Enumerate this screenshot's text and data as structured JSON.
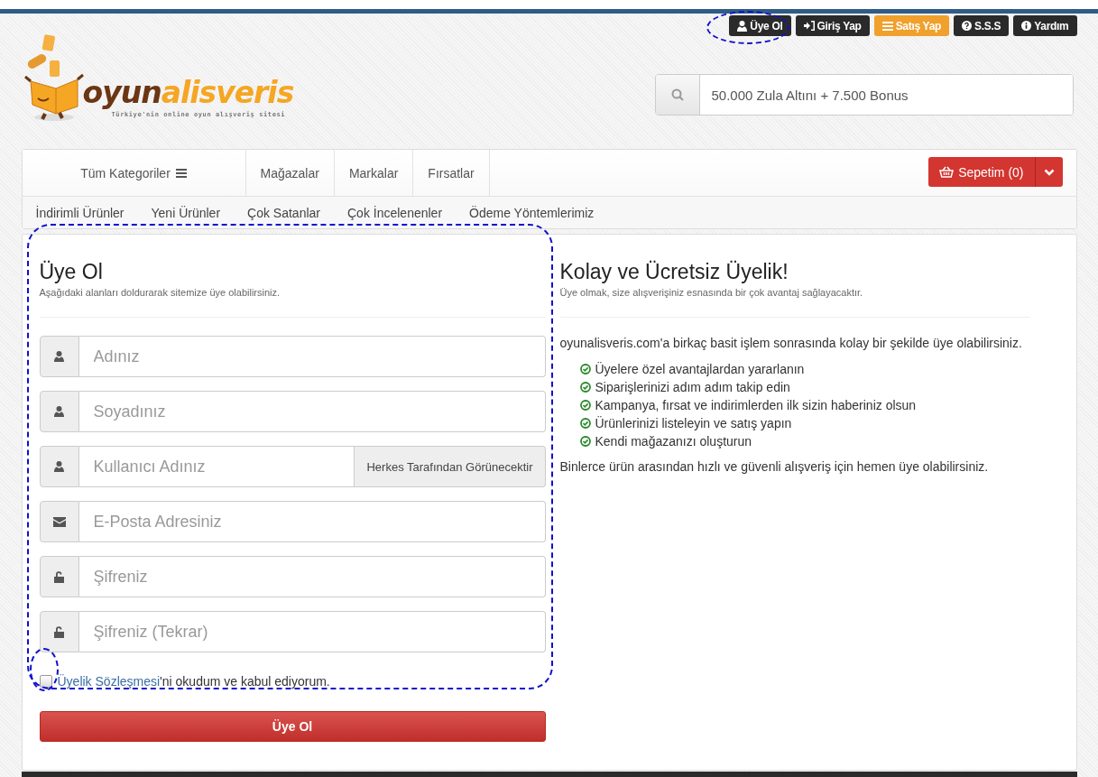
{
  "top_buttons": [
    {
      "label": "Üye Ol",
      "kind": "dark"
    },
    {
      "label": "Giriş Yap",
      "kind": "dark"
    },
    {
      "label": "Satış Yap",
      "kind": "orange"
    },
    {
      "label": "S.S.S",
      "kind": "dark"
    },
    {
      "label": "Yardım",
      "kind": "dark"
    }
  ],
  "logo": {
    "word_1": "oyun",
    "word_2": "alisveris",
    "tagline": "Türkiye'nin online oyun alışveriş sitesi"
  },
  "search": {
    "value": "50.000 Zula Altını + 7.500 Bonus"
  },
  "nav": {
    "categories": "Tüm Kategoriler",
    "links": [
      "Mağazalar",
      "Markalar",
      "Fırsatlar"
    ],
    "cart": "Sepetim (0)",
    "sub_links": [
      "İndirimli Ürünler",
      "Yeni Ürünler",
      "Çok Satanlar",
      "Çok İncelenenler",
      "Ödeme Yöntemlerimiz"
    ]
  },
  "form": {
    "title": "Üye Ol",
    "subtitle": "Aşağıdaki alanları doldurarak sitemize üye olabilirsiniz.",
    "fields": [
      {
        "kind": "text",
        "placeholder": "Adınız"
      },
      {
        "kind": "text",
        "placeholder": "Soyadınız"
      },
      {
        "kind": "text",
        "placeholder": "Kullanıcı Adınız",
        "addon": "Herkes Tarafından Görünecektir"
      },
      {
        "kind": "email",
        "placeholder": "E-Posta Adresiniz"
      },
      {
        "kind": "password",
        "placeholder": "Şifreniz"
      },
      {
        "kind": "password",
        "placeholder": "Şifreniz (Tekrar)"
      }
    ],
    "agreement": {
      "checked": false,
      "link": "Üyelik Sözleşmesi",
      "text": "'ni okudum ve kabul ediyorum."
    },
    "submit": "Üye Ol"
  },
  "info": {
    "title": "Kolay ve Ücretsiz Üyelik!",
    "subtitle": "Üye olmak, size alışverişiniz esnasında bir çok avantaj sağlayacaktır.",
    "intro": "oyunalisveris.com'a birkaç basit işlem sonrasında kolay bir şekilde üye olabilirsiniz.",
    "benefits": [
      "Üyelere özel avantajlardan yararlanın",
      "Siparişlerinizi adım adım takip edin",
      "Kampanya, fırsat ve indirimlerden ilk sizin haberiniz olsun",
      "Ürünlerinizi listeleyin ve satış yapın",
      "Kendi mağazanızı oluşturun"
    ],
    "outro": "Binlerce ürün arasından hızlı ve güvenli alışveriş için hemen üye olabilirsiniz."
  }
}
